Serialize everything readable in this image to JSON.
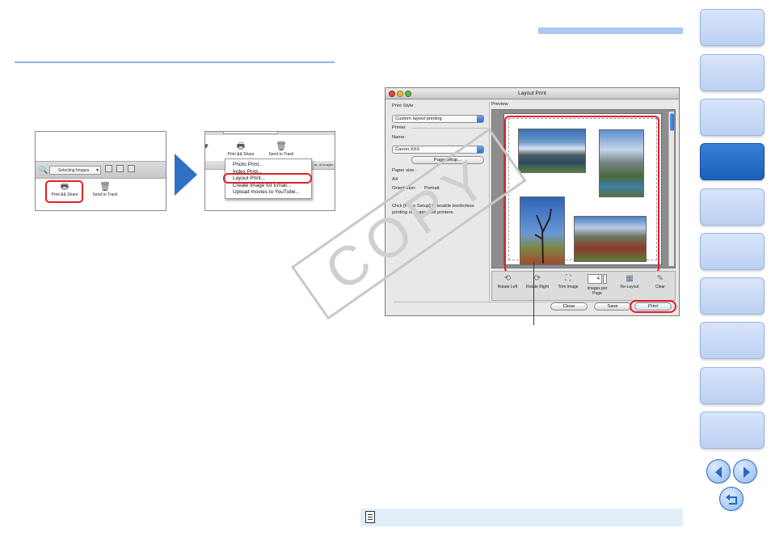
{
  "toolbar_shot": {
    "selecting_images": "Selecting Images",
    "print_share": "Print && Share",
    "send_to_trash": "Send to Trash"
  },
  "menu_shot": {
    "print_share": "Print && Share",
    "send_to_trash": "Send to Trash",
    "band_text": "ss. of images",
    "items": [
      "Photo Print...",
      "Index Print...",
      "Layout Print...",
      "Create Image for Email...",
      "Upload movies to YouTube..."
    ],
    "highlighted_item": "Layout Print..."
  },
  "window": {
    "title": "Layout Print",
    "print_style_label": "Print Style",
    "print_style_value": "Custom layout printing",
    "printer_label": "Printer",
    "name_label": "Name:",
    "name_value": "Canon XXX",
    "page_setup_button": "Page setup...",
    "paper_size_label": "Paper size :",
    "paper_size_value": "A4",
    "orientation_label": "Orientation:",
    "orientation_value": "Portrait",
    "note_text": "Click [Page Setup] to enable borderless printing on supported printers.",
    "preview_label": "Preview",
    "tools": {
      "rotate_left": "Rotate Left",
      "rotate_right": "Rotate Right",
      "trim_image": "Trim Image",
      "images_per_page": "Images per Page",
      "images_per_page_value": "4",
      "re_layout": "Re-Layout",
      "clear": "Clear"
    },
    "close_button": "Close",
    "save_button": "Save",
    "print_button": "Print"
  },
  "watermark": "COPY",
  "colors": {
    "highlight": "#e0202a",
    "nav_tab": "#c9daf6",
    "nav_tab_active": "#2468c4",
    "accent_bar": "#a9c8f2",
    "note_bar": "#e3eefb"
  }
}
